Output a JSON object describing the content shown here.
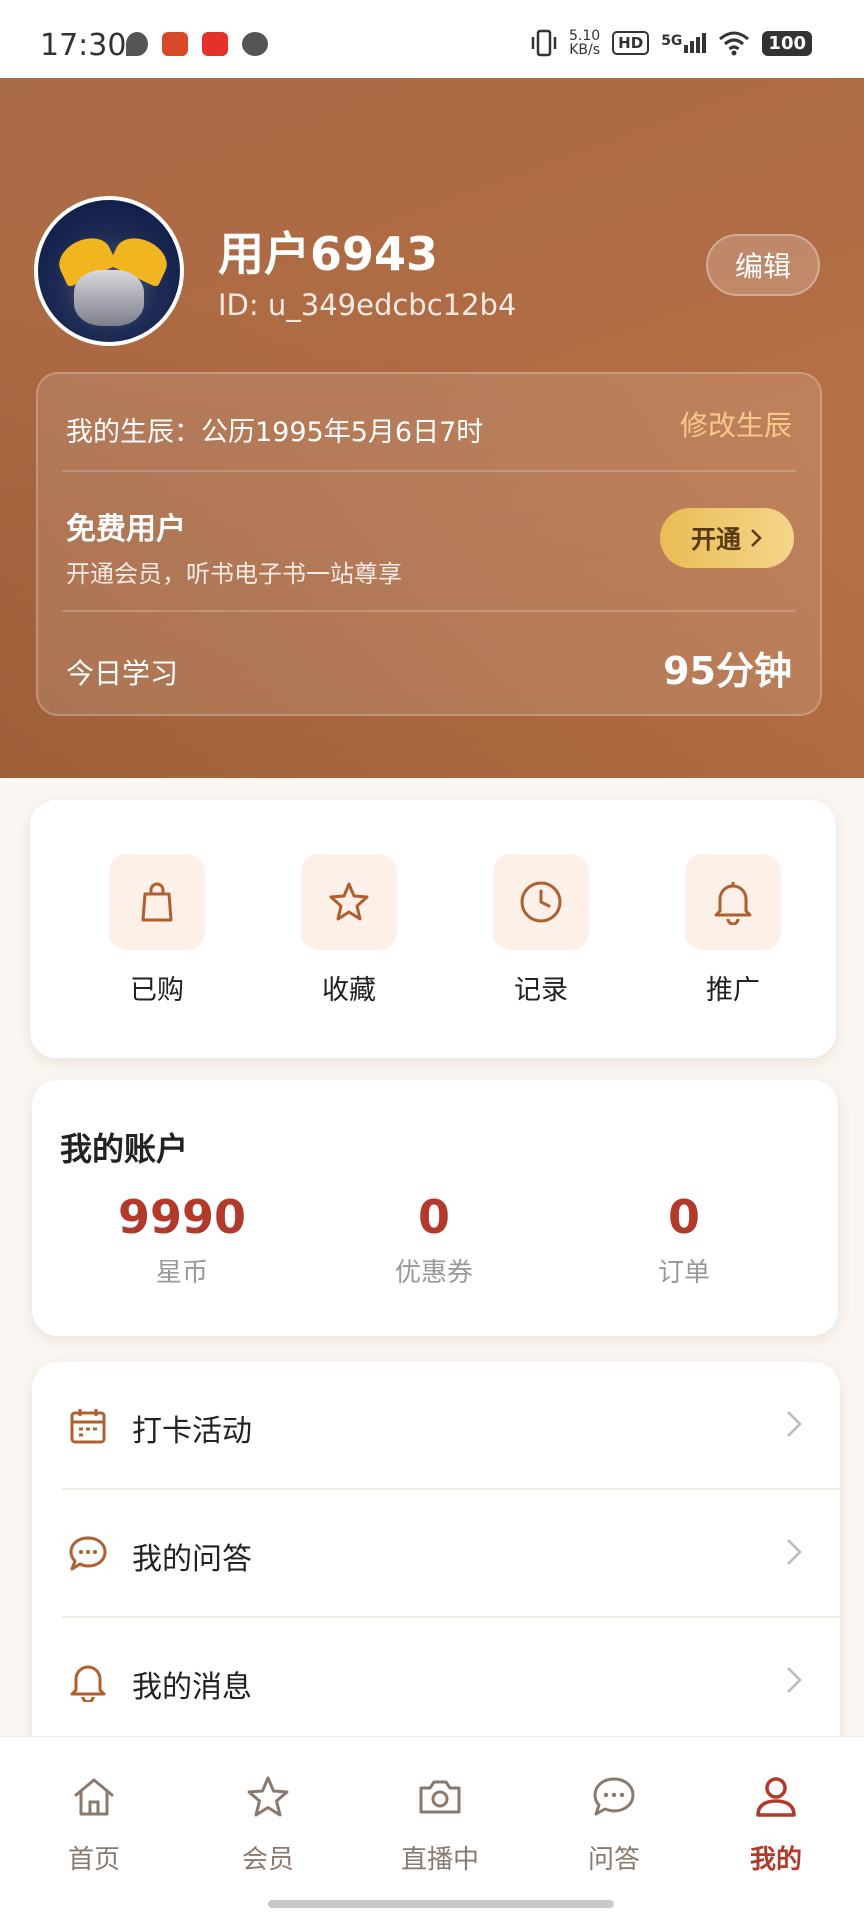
{
  "status_bar": {
    "time": "17:30",
    "net_speed_value": "5.10",
    "net_speed_unit": "KB/s",
    "hd_badge": "HD",
    "network": "5G",
    "battery": "100"
  },
  "profile": {
    "username": "用户6943",
    "user_id": "ID: u_349edcbc12b4",
    "edit_label": "编辑"
  },
  "info_card": {
    "birth_text": "我的生辰：公历1995年5月6日7时",
    "birth_edit_label": "修改生辰",
    "member_title": "免费用户",
    "member_subtitle": "开通会员，听书电子书一站尊享",
    "open_label": "开通",
    "study_label": "今日学习",
    "study_value": "95分钟"
  },
  "quick_actions": [
    {
      "label": "已购",
      "icon": "shopping-bag-icon"
    },
    {
      "label": "收藏",
      "icon": "star-icon"
    },
    {
      "label": "记录",
      "icon": "clock-icon"
    },
    {
      "label": "推广",
      "icon": "bell-icon"
    }
  ],
  "account": {
    "title": "我的账户",
    "items": [
      {
        "value": "9990",
        "label": "星币"
      },
      {
        "value": "0",
        "label": "优惠券"
      },
      {
        "value": "0",
        "label": "订单"
      }
    ]
  },
  "menu": [
    {
      "label": "打卡活动",
      "icon": "calendar-icon"
    },
    {
      "label": "我的问答",
      "icon": "chat-bubble-icon"
    },
    {
      "label": "我的消息",
      "icon": "bell-icon"
    }
  ],
  "tabs": [
    {
      "label": "首页",
      "icon": "home-icon",
      "active": false
    },
    {
      "label": "会员",
      "icon": "star-icon",
      "active": false
    },
    {
      "label": "直播中",
      "icon": "camera-icon",
      "active": false
    },
    {
      "label": "问答",
      "icon": "chat-bubble-icon",
      "active": false
    },
    {
      "label": "我的",
      "icon": "user-icon",
      "active": true
    }
  ],
  "colors": {
    "accent": "#b23a2a",
    "header_brown": "#b06c44",
    "icon_brown": "#b0602e",
    "gold": "#e9bd55"
  }
}
